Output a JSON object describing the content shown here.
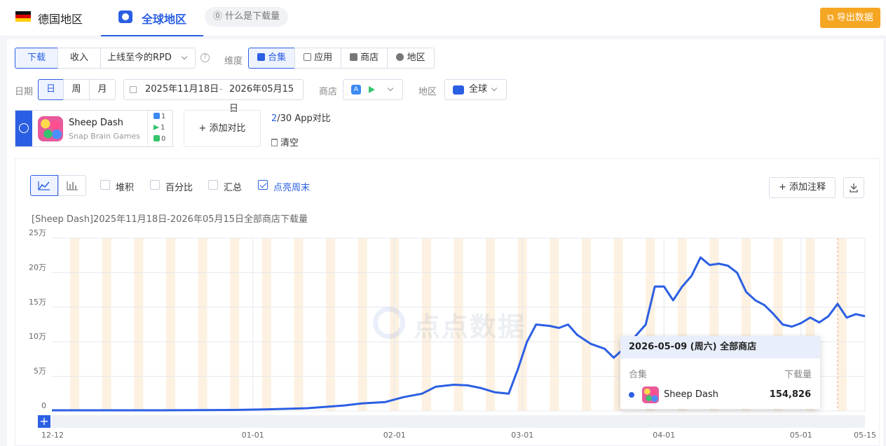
{
  "header": {
    "region_title": "德国地区",
    "global_tab": "全球地区",
    "help_pill": "⓪ 什么是下载量",
    "export_label": "导出数据"
  },
  "metric_tabs": [
    "下载",
    "收入"
  ],
  "rpd_select": "上线至今的RPD",
  "dimension": {
    "label": "维度",
    "options": [
      "合集",
      "应用",
      "商店",
      "地区"
    ],
    "selected": "合集"
  },
  "date": {
    "label": "日期",
    "granularity": [
      "日",
      "周",
      "月"
    ],
    "selected": "日",
    "start": "2025年11月18日",
    "separator": "-",
    "end": "2026年05月15日"
  },
  "store_label": "商店",
  "area": {
    "label": "地区",
    "value": "全球"
  },
  "app": {
    "name": "Sheep Dash",
    "developer": "Snap Brain Games",
    "counts": [
      "1",
      "1",
      "0"
    ]
  },
  "add_compare": "+ 添加对比",
  "compare_count": {
    "used": "2",
    "rest": "/30 App对比"
  },
  "clear_label": "清空",
  "chart_options": [
    {
      "label": "堆积",
      "checked": false
    },
    {
      "label": "百分比",
      "checked": false
    },
    {
      "label": "汇总",
      "checked": false
    },
    {
      "label": "点亮周末",
      "checked": true
    }
  ],
  "add_annotation": "+ 添加注释",
  "chart_caption": "[Sheep Dash]2025年11月18日-2026年05月15日全部商店下载量",
  "watermark": "点点数据",
  "tooltip": {
    "date_line": "2026-05-09 (周六) 全部商店",
    "col_left": "合集",
    "col_right": "下载量",
    "app_name": "Sheep Dash",
    "value": "154,826"
  },
  "colors": {
    "accent": "#2b5fe3",
    "weekend": "#fdf1e1",
    "export": "#f5a623"
  },
  "chart_data": {
    "type": "line",
    "title": "[Sheep Dash]2025年11月18日-2026年05月15日全部商店下载量",
    "y_ticks": [
      "0",
      "5万",
      "10万",
      "15万",
      "20万",
      "25万"
    ],
    "ylim": [
      0,
      250000
    ],
    "x_ticks": [
      "12-12",
      "01-01",
      "02-01",
      "03-01",
      "04-01",
      "05-01",
      "05-15"
    ],
    "series": [
      {
        "name": "Sheep Dash",
        "x": [
          "2025-12-12",
          "2025-12-20",
          "2025-12-28",
          "2026-01-05",
          "2026-01-13",
          "2026-01-21",
          "2026-01-25",
          "2026-01-30",
          "2026-02-03",
          "2026-02-07",
          "2026-02-10",
          "2026-02-14",
          "2026-02-17",
          "2026-02-20",
          "2026-02-23",
          "2026-02-26",
          "2026-02-28",
          "2026-03-02",
          "2026-03-04",
          "2026-03-07",
          "2026-03-09",
          "2026-03-11",
          "2026-03-13",
          "2026-03-16",
          "2026-03-19",
          "2026-03-21",
          "2026-03-24",
          "2026-03-26",
          "2026-03-28",
          "2026-03-30",
          "2026-04-01",
          "2026-04-03",
          "2026-04-05",
          "2026-04-07",
          "2026-04-09",
          "2026-04-11",
          "2026-04-13",
          "2026-04-15",
          "2026-04-17",
          "2026-04-19",
          "2026-04-21",
          "2026-04-23",
          "2026-04-25",
          "2026-04-27",
          "2026-04-29",
          "2026-05-01",
          "2026-05-03",
          "2026-05-05",
          "2026-05-07",
          "2026-05-09",
          "2026-05-11",
          "2026-05-13",
          "2026-05-15"
        ],
        "y": [
          1000,
          1200,
          1500,
          2500,
          4000,
          8000,
          11000,
          13000,
          20000,
          25000,
          35000,
          38000,
          37000,
          33000,
          27000,
          25000,
          60000,
          100000,
          125000,
          123000,
          120000,
          125000,
          110000,
          97000,
          90000,
          77000,
          95000,
          110000,
          125000,
          180000,
          180000,
          160000,
          180000,
          195000,
          222000,
          211000,
          213000,
          210000,
          200000,
          172000,
          160000,
          153000,
          140000,
          125000,
          122000,
          127000,
          135000,
          128000,
          137000,
          154826,
          135000,
          140000,
          137000
        ]
      }
    ]
  }
}
